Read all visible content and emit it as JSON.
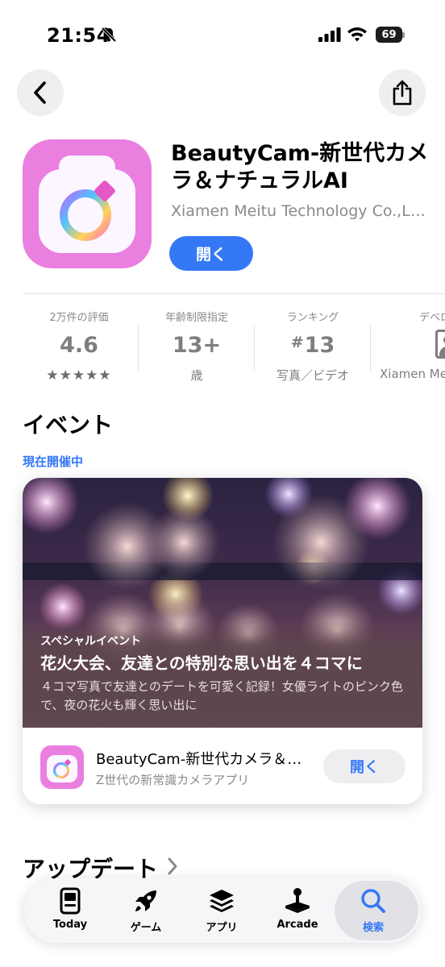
{
  "status_bar": {
    "time": "21:54",
    "battery": "69"
  },
  "app": {
    "title": "BeautyCam-新世代カメラ＆ナチュラルAI",
    "developer": "Xiamen Meitu Technology Co.,Ltd.",
    "open_label": "開く"
  },
  "info": {
    "ratings": {
      "label": "2万件の評価",
      "value": "4.6",
      "stars": "★★★★★"
    },
    "age": {
      "label": "年齢制限指定",
      "value": "13+",
      "sub": "歳"
    },
    "rank": {
      "label": "ランキング",
      "hash": "#",
      "value": "13",
      "sub": "写真／ビデオ"
    },
    "developer": {
      "label": "デベロッパ",
      "sub": "Xiamen Meitu"
    }
  },
  "events": {
    "title": "イベント",
    "status": "現在開催中",
    "card": {
      "kicker": "スペシャルイベント",
      "headline": "花火大会、友達との特別な思い出を４コマに",
      "description": "４コマ写真で友達とのデートを可愛く記録！女優ライトのピンク色で、夜の花火も輝く思い出に",
      "app_name": "BeautyCam-新世代カメラ＆ナチュラルAI",
      "app_tagline": "Z世代の新常識カメラアプリ",
      "open_label": "開く"
    }
  },
  "updates": {
    "title": "アップデート"
  },
  "tabbar": {
    "tabs": [
      {
        "label": "Today",
        "icon": "today-icon"
      },
      {
        "label": "ゲーム",
        "icon": "rocket-icon"
      },
      {
        "label": "アプリ",
        "icon": "stack-icon"
      },
      {
        "label": "Arcade",
        "icon": "joystick-icon"
      },
      {
        "label": "検索",
        "icon": "search-icon",
        "active": true
      }
    ]
  },
  "colors": {
    "accent": "#3478f6",
    "app_icon_bg": "#ea7fe0",
    "event_overlay": "#5e4750"
  }
}
